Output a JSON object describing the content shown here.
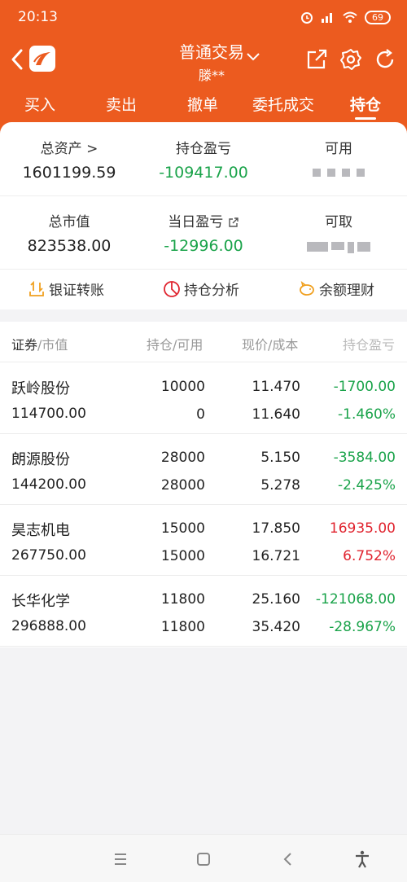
{
  "status": {
    "time": "20:13",
    "battery": "69"
  },
  "header": {
    "title": "普通交易",
    "account": "滕**"
  },
  "tabs": [
    {
      "label": "买入"
    },
    {
      "label": "卖出"
    },
    {
      "label": "撤单"
    },
    {
      "label": "委托成交"
    },
    {
      "label": "持仓"
    }
  ],
  "summary": {
    "total_assets_label": "总资产 >",
    "total_assets": "1601199.59",
    "position_pl_label": "持仓盈亏",
    "position_pl": "-109417.00",
    "available_label": "可用",
    "market_value_label": "总市值",
    "market_value": "823538.00",
    "daily_pl_label": "当日盈亏",
    "daily_pl": "-12996.00",
    "withdrawable_label": "可取"
  },
  "shortcuts": [
    {
      "label": "银证转账",
      "icon": "transfer-icon"
    },
    {
      "label": "持仓分析",
      "icon": "pie-chart-icon"
    },
    {
      "label": "余额理财",
      "icon": "piggy-bank-icon"
    }
  ],
  "table": {
    "headers": {
      "security": "证券",
      "market_value": "/市值",
      "position": "持仓/可用",
      "price": "现价/成本",
      "pl": "持仓盈亏"
    },
    "rows": [
      {
        "name": "跃岭股份",
        "value": "114700.00",
        "position": "10000",
        "available": "0",
        "price": "11.470",
        "cost": "11.640",
        "pl": "-1700.00",
        "pl_pct": "-1.460%",
        "trend": "down"
      },
      {
        "name": "朗源股份",
        "value": "144200.00",
        "position": "28000",
        "available": "28000",
        "price": "5.150",
        "cost": "5.278",
        "pl": "-3584.00",
        "pl_pct": "-2.425%",
        "trend": "down"
      },
      {
        "name": "昊志机电",
        "value": "267750.00",
        "position": "15000",
        "available": "15000",
        "price": "17.850",
        "cost": "16.721",
        "pl": "16935.00",
        "pl_pct": "6.752%",
        "trend": "up"
      },
      {
        "name": "长华化学",
        "value": "296888.00",
        "position": "11800",
        "available": "11800",
        "price": "25.160",
        "cost": "35.420",
        "pl": "-121068.00",
        "pl_pct": "-28.967%",
        "trend": "down"
      }
    ]
  },
  "colors": {
    "brand": "#ec5b1f",
    "loss": "#1aa34a",
    "gain": "#e0242f",
    "icon_accent": "#f0a020"
  }
}
